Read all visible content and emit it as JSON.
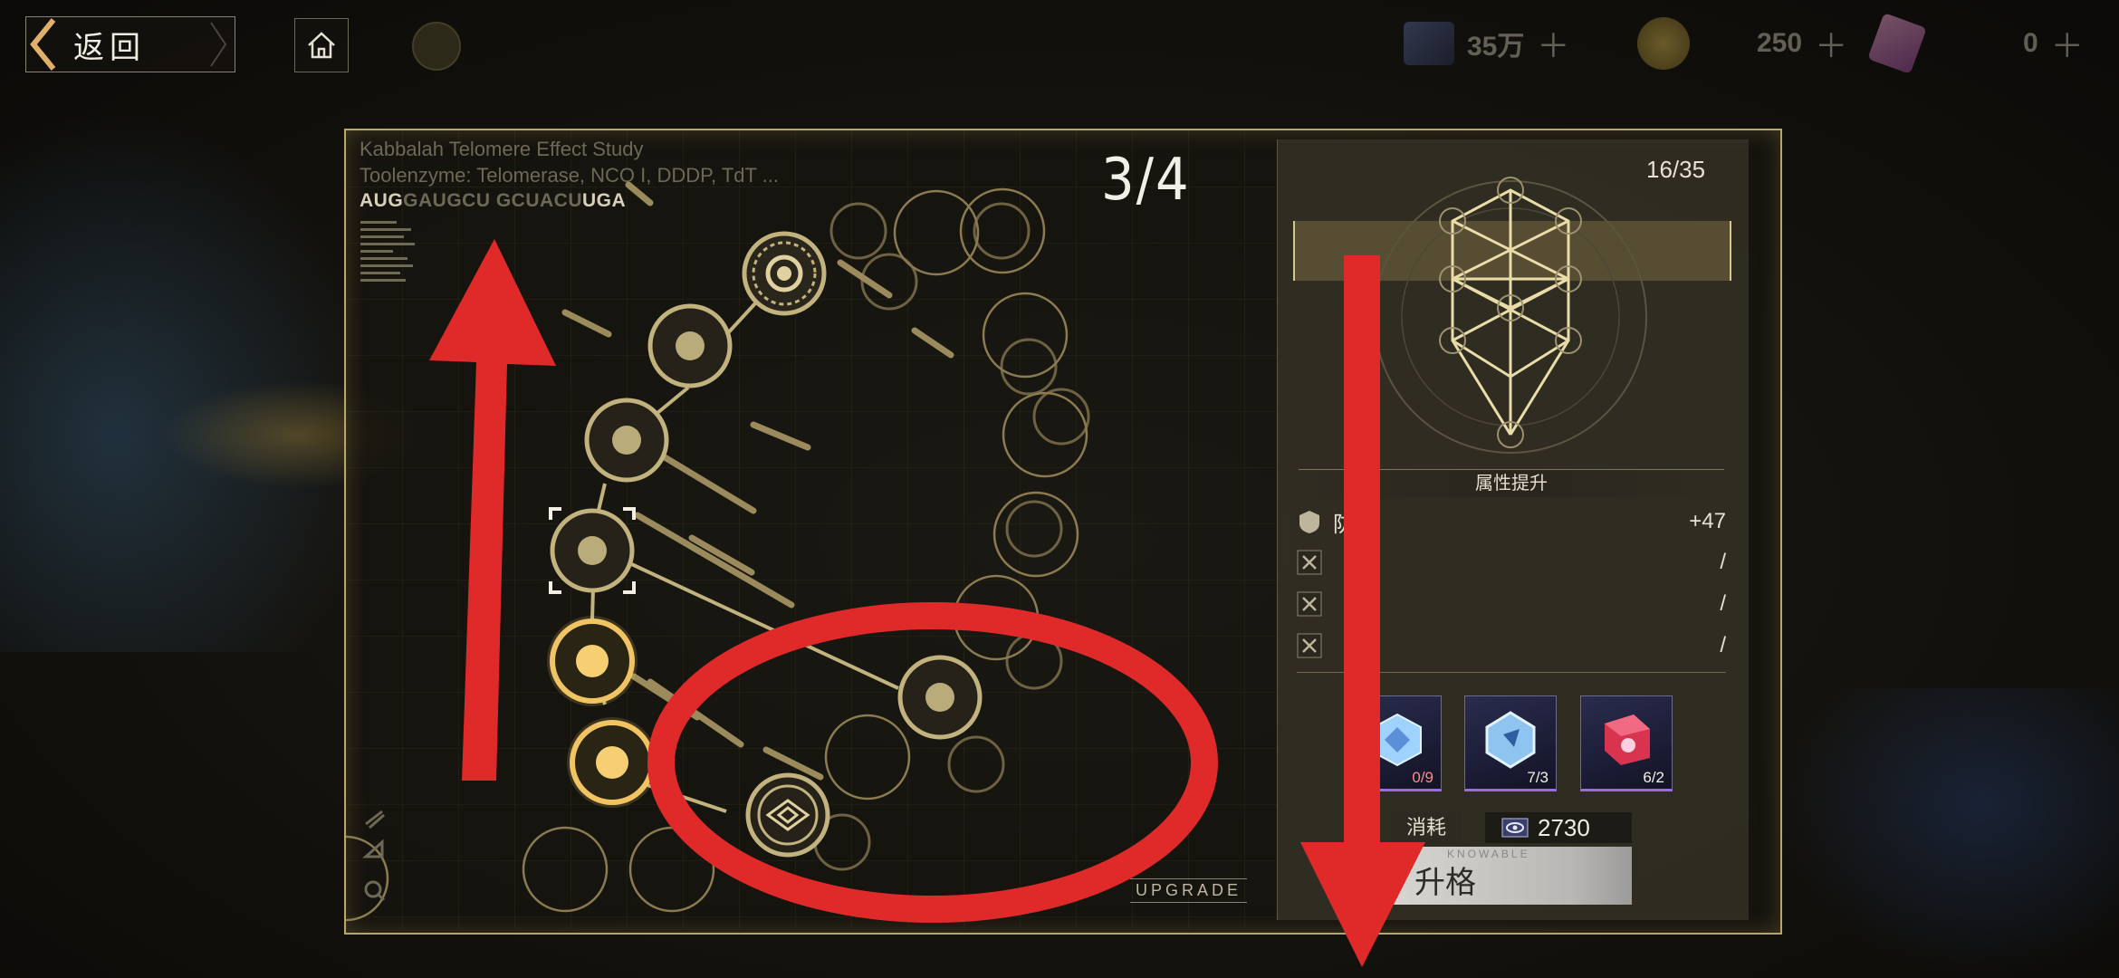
{
  "topbar": {
    "back_label": "返回",
    "resources": [
      {
        "icon": "card-ticket-icon",
        "value": "35万"
      },
      {
        "icon": "gold-coin-icon",
        "value": "250"
      },
      {
        "icon": "pink-crystal-icon",
        "value": "0"
      }
    ]
  },
  "study": {
    "title": "Kabbalah Telomere Effect Study",
    "subtitle": "Toolenzyme: Telomerase, NCO I, DDDP, TdT ...",
    "sequence_dim1": "",
    "sequence_bright1": "AUG",
    "sequence_dim2": "GAUGCU GCUACU",
    "sequence_bright2": "UGA"
  },
  "page_indicator": "3/4",
  "upgrade_tag": "UPGRADE",
  "detail": {
    "progress": "16/35",
    "attr_header": "属性提升",
    "attrs": [
      {
        "icon": "shield-icon",
        "name": "防",
        "value": "+47"
      },
      {
        "icon": "locked-x-icon",
        "name": "",
        "value": "/"
      },
      {
        "icon": "locked-x-icon",
        "name": "",
        "value": "/"
      },
      {
        "icon": "locked-x-icon",
        "name": "",
        "value": "/"
      }
    ],
    "materials": [
      {
        "icon": "blue-crystal-icon",
        "count": "0/9",
        "insufficient": true
      },
      {
        "icon": "blue-gem-icon",
        "count": "7/3",
        "insufficient": false
      },
      {
        "icon": "red-cube-icon",
        "count": "6/2",
        "insufficient": false
      }
    ],
    "cost_label": "消耗",
    "cost_value": "2730",
    "cost_icon": "eye-token-icon",
    "upgrade_sub": "KNOWABLE",
    "upgrade_button": "升格"
  },
  "colors": {
    "accent_gold": "#b9a66a",
    "node_active": "#f1c463",
    "annotation_red": "#e02a2a"
  }
}
